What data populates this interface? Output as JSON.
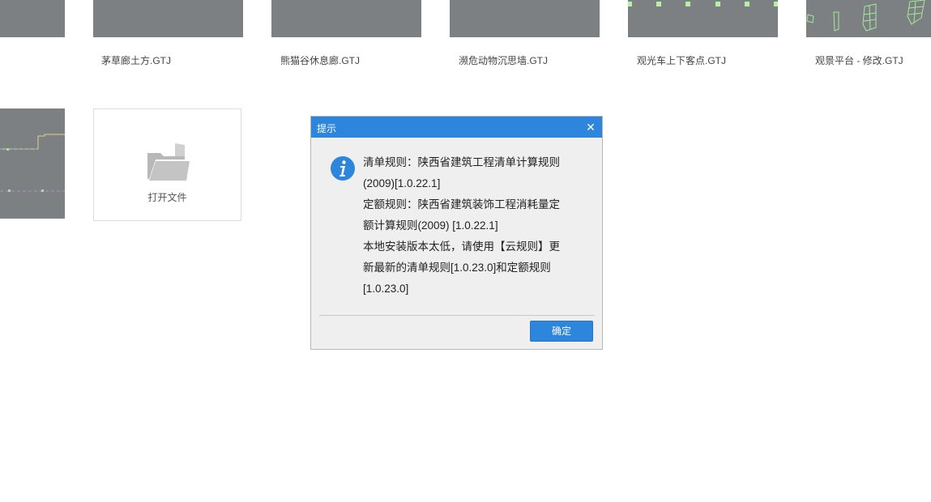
{
  "files": [
    {
      "name": "茅草廊土方.GTJ"
    },
    {
      "name": "熊猫谷休息廊.GTJ"
    },
    {
      "name": "濒危动物沉思墙.GTJ"
    },
    {
      "name": "观光车上下客点.GTJ"
    },
    {
      "name": "观景平台 - 修改.GTJ"
    }
  ],
  "open_tile": {
    "label": "打开文件",
    "icon": "folder-icon"
  },
  "dialog": {
    "title": "提示",
    "close_icon": "close-icon",
    "info_icon": "info-icon",
    "message_lines": [
      "清单规则：陕西省建筑工程清单计算规则",
      "(2009)[1.0.22.1]",
      "定额规则：陕西省建筑装饰工程消耗量定",
      "额计算规则(2009) [1.0.22.1]",
      "本地安装版本太低，请使用【云规则】更",
      "新最新的清单规则[1.0.23.0]和定额规则",
      "[1.0.23.0]"
    ],
    "ok_label": "确定"
  },
  "colors": {
    "accent": "#2e85dc",
    "thumb_bg": "#7c8083",
    "dialog_bg": "#efefef"
  }
}
